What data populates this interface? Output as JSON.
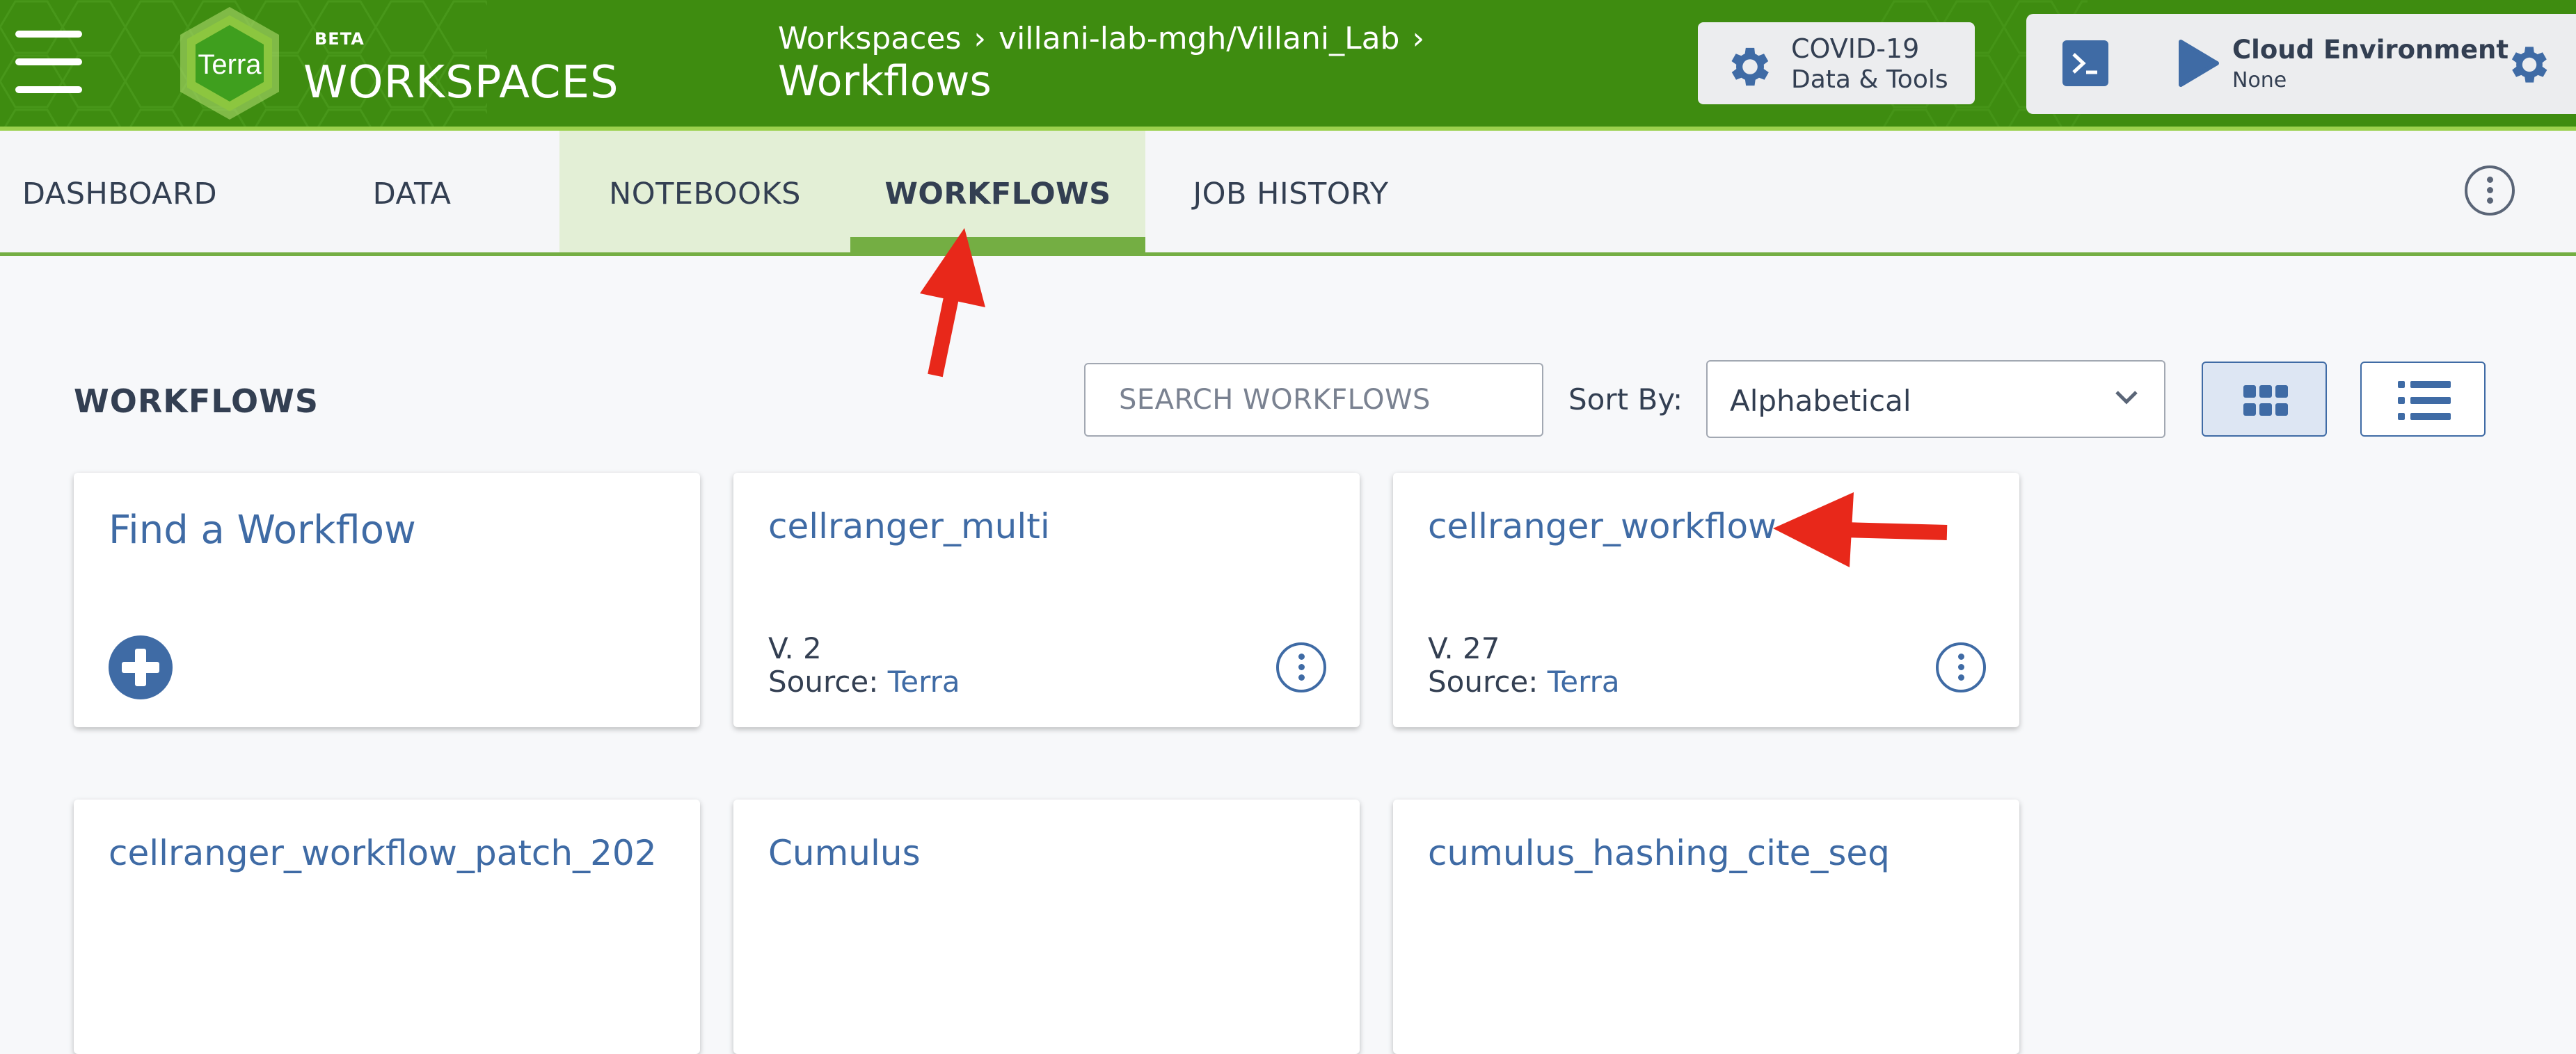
{
  "header": {
    "beta_label": "BETA",
    "logo_text": "Terra",
    "brand": "WORKSPACES",
    "breadcrumb": [
      "Workspaces",
      "villani-lab-mgh/Villani_Lab"
    ],
    "breadcrumb_separator": "›",
    "page_title": "Workflows",
    "covid_button": {
      "line1": "COVID-19",
      "line2": "Data & Tools"
    },
    "cloud_environment": {
      "title": "Cloud Environment",
      "status": "None"
    },
    "colors": {
      "header_green": "#3e8c10",
      "accent_green": "#74ae43",
      "link_blue": "#3f6ba5"
    }
  },
  "tabs": [
    {
      "label": "DASHBOARD"
    },
    {
      "label": "DATA"
    },
    {
      "label": "NOTEBOOKS"
    },
    {
      "label": "WORKFLOWS"
    },
    {
      "label": "JOB HISTORY"
    }
  ],
  "active_tab": "WORKFLOWS",
  "toolbar": {
    "section_title": "WORKFLOWS",
    "search_placeholder": "SEARCH WORKFLOWS",
    "sort_label": "Sort By:",
    "sort_value": "Alphabetical",
    "view_mode": "grid"
  },
  "find_card": {
    "title": "Find a Workflow",
    "icon": "plus-circle-icon"
  },
  "workflows": [
    {
      "name": "cellranger_multi",
      "version": "V. 2",
      "source_label": "Source:",
      "source": "Terra"
    },
    {
      "name": "cellranger_workflow",
      "version": "V. 27",
      "source_label": "Source:",
      "source": "Terra"
    }
  ],
  "more_workflows": [
    {
      "name": "cellranger_workflow_patch_202"
    },
    {
      "name": "Cumulus"
    },
    {
      "name": "cumulus_hashing_cite_seq"
    }
  ]
}
